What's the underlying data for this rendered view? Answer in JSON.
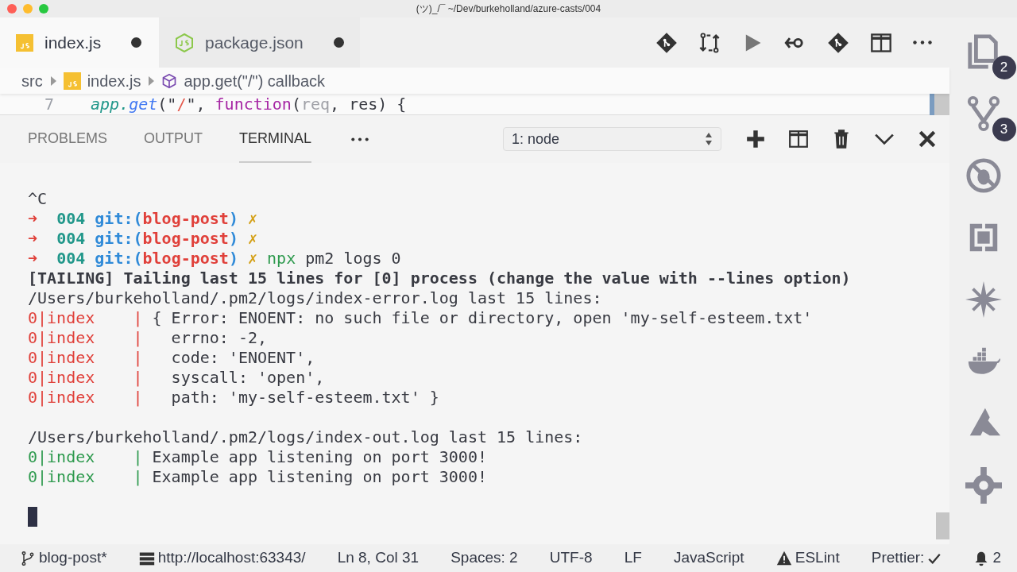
{
  "window": {
    "title": "(ツ)_/¯ ~/Dev/burkeholland/azure-casts/004"
  },
  "editor_tabs": [
    {
      "label": "index.js",
      "kind": "js",
      "selected": true,
      "dirty": true
    },
    {
      "label": "package.json",
      "kind": "node",
      "selected": false,
      "dirty": true
    }
  ],
  "breadcrumbs": [
    {
      "label": "src",
      "kind": "folder"
    },
    {
      "label": "index.js",
      "kind": "js"
    },
    {
      "label": "app.get(\"/\") callback",
      "kind": "symbol"
    }
  ],
  "code_line": {
    "number": "7",
    "tokens": [
      {
        "text": "app",
        "kind": "object"
      },
      {
        "text": ".",
        "kind": "object"
      },
      {
        "text": "get",
        "kind": "method"
      },
      {
        "text": "(\"",
        "kind": "punct"
      },
      {
        "text": "/",
        "kind": "string"
      },
      {
        "text": "\", ",
        "kind": "punct"
      },
      {
        "text": "function",
        "kind": "keyword"
      },
      {
        "text": "(",
        "kind": "punct"
      },
      {
        "text": "req",
        "kind": "unused"
      },
      {
        "text": ", res) {",
        "kind": "punct"
      }
    ]
  },
  "panel_tabs": [
    {
      "label": "PROBLEMS",
      "selected": false
    },
    {
      "label": "OUTPUT",
      "selected": false
    },
    {
      "label": "TERMINAL",
      "selected": true
    }
  ],
  "terminal_select": {
    "value": "1: node"
  },
  "terminal_blocks": [
    [
      [
        {
          "text": "^C",
          "kind": "plain"
        }
      ],
      [
        {
          "text": "➜ ",
          "kind": "arrow"
        },
        {
          "text": " 004 ",
          "kind": "dir"
        },
        {
          "text": "git:(",
          "kind": "git"
        },
        {
          "text": "blog-post",
          "kind": "branch"
        },
        {
          "text": ")",
          "kind": "git"
        },
        {
          "text": " ✗",
          "kind": "dirty"
        }
      ],
      [
        {
          "text": "➜ ",
          "kind": "arrow"
        },
        {
          "text": " 004 ",
          "kind": "dir"
        },
        {
          "text": "git:(",
          "kind": "git"
        },
        {
          "text": "blog-post",
          "kind": "branch"
        },
        {
          "text": ")",
          "kind": "git"
        },
        {
          "text": " ✗",
          "kind": "dirty"
        }
      ],
      [
        {
          "text": "➜ ",
          "kind": "arrow"
        },
        {
          "text": " 004 ",
          "kind": "dir"
        },
        {
          "text": "git:(",
          "kind": "git"
        },
        {
          "text": "blog-post",
          "kind": "branch"
        },
        {
          "text": ")",
          "kind": "git"
        },
        {
          "text": " ✗ ",
          "kind": "dirty"
        },
        {
          "text": "npx",
          "kind": "command"
        },
        {
          "text": " pm2 logs 0",
          "kind": "plain"
        }
      ],
      [
        {
          "text": "[TAILING] Tailing last 15 lines for [0] process (change the value with --lines option)",
          "kind": "bold"
        }
      ],
      [
        {
          "text": "/Users/burkeholland/.pm2/logs/index-error.log last 15 lines:",
          "kind": "plain"
        }
      ],
      [
        {
          "text": "0|index    |",
          "kind": "error"
        },
        {
          "text": " { Error: ENOENT: no such file or directory, open 'my-self-esteem.txt'",
          "kind": "plain"
        }
      ],
      [
        {
          "text": "0|index    |",
          "kind": "error"
        },
        {
          "text": "   errno: -2,",
          "kind": "plain"
        }
      ],
      [
        {
          "text": "0|index    |",
          "kind": "error"
        },
        {
          "text": "   code: 'ENOENT',",
          "kind": "plain"
        }
      ],
      [
        {
          "text": "0|index    |",
          "kind": "error"
        },
        {
          "text": "   syscall: 'open',",
          "kind": "plain"
        }
      ],
      [
        {
          "text": "0|index    |",
          "kind": "error"
        },
        {
          "text": "   path: 'my-self-esteem.txt' }",
          "kind": "plain"
        }
      ]
    ],
    [
      [
        {
          "text": "/Users/burkeholland/.pm2/logs/index-out.log last 15 lines:",
          "kind": "plain"
        }
      ],
      [
        {
          "text": "0|index    |",
          "kind": "ok"
        },
        {
          "text": " Example app listening on port 3000!",
          "kind": "plain"
        }
      ],
      [
        {
          "text": "0|index    |",
          "kind": "ok"
        },
        {
          "text": " Example app listening on port 3000!",
          "kind": "plain"
        }
      ]
    ]
  ],
  "activity_badges": [
    "2",
    "3"
  ],
  "status_bar": [
    "blog-post*",
    "http://localhost:63343/",
    "Ln 8, Col 31",
    "Spaces: 2",
    "UTF-8",
    "LF",
    "JavaScript",
    "ESLint",
    "Prettier:",
    "2"
  ]
}
